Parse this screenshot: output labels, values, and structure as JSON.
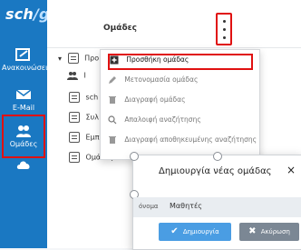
{
  "brand": {
    "name": "sch",
    "suffix": "/gr"
  },
  "sidebar": {
    "items": [
      {
        "label": "Ανακοινώσεις",
        "icon": "announcement-icon"
      },
      {
        "label": "E-Mail",
        "icon": "mail-icon"
      },
      {
        "label": "Ομάδες",
        "icon": "groups-icon",
        "active": true
      },
      {
        "label": "",
        "icon": "cloud-icon"
      }
    ]
  },
  "header": {
    "title": "Ομάδες"
  },
  "tree": {
    "items": [
      {
        "label": "Προ"
      },
      {
        "label": "Ι"
      },
      {
        "label": "sch"
      },
      {
        "label": "Συλ"
      },
      {
        "label": "Εμπ"
      },
      {
        "label": "Ομάδες Αλλη"
      }
    ]
  },
  "menu": {
    "items": [
      {
        "label": "Προσθήκη ομάδας",
        "icon": "add-square-icon",
        "highlighted": true
      },
      {
        "label": "Μετονομασία ομάδας",
        "icon": "pencil-icon"
      },
      {
        "label": "Διαγραφή ομάδας",
        "icon": "trash-icon"
      },
      {
        "label": "Απαλοιφή αναζήτησης",
        "icon": "search-icon"
      },
      {
        "label": "Διαγραφή αποθηκευμένης αναζήτησης",
        "icon": "trash-icon"
      }
    ]
  },
  "modal": {
    "title": "Δημιουργία νέας ομάδας",
    "name_label": "όνομα",
    "name_value": "Μαθητές",
    "create_label": "Δημιουργία",
    "cancel_label": "Ακύρωση",
    "close_symbol": "×"
  },
  "colors": {
    "sidebar_bg": "#1a78c2",
    "highlight_border": "#e01111",
    "primary_button": "#4a9de3",
    "secondary_button": "#7b8794"
  }
}
